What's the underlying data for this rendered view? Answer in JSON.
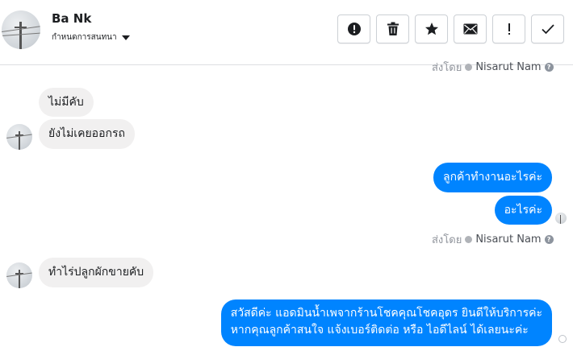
{
  "header": {
    "contact_name": "Ba Nk",
    "conversation_settings": "กำหนดการสนทนา",
    "toolbar": [
      {
        "name": "spam-button",
        "icon": "alert-circle-icon"
      },
      {
        "name": "delete-button",
        "icon": "trash-icon"
      },
      {
        "name": "star-button",
        "icon": "star-icon"
      },
      {
        "name": "mark-unread-button",
        "icon": "envelope-icon"
      },
      {
        "name": "follow-up-button",
        "icon": "exclamation-icon"
      },
      {
        "name": "mark-done-button",
        "icon": "checkmark-icon"
      }
    ]
  },
  "sent_by_label": "ส่งโดย",
  "agent_name": "Nisarut Nam",
  "messages": [
    {
      "direction": "in",
      "text": "ไม่มีคับ"
    },
    {
      "direction": "in",
      "text": "ยังไม่เคยออกรถ"
    },
    {
      "direction": "out",
      "text": "ลูกค้าทำงานอะไรค่ะ"
    },
    {
      "direction": "out",
      "text": "อะไรค่ะ"
    },
    {
      "direction": "in",
      "text": "ทำไร่ปลูกผักขายคับ"
    },
    {
      "direction": "out",
      "text_lines": [
        "สวัสดีค่ะ แอดมินน้ำเพจากร้านโชคคุณโชคอุดร ยินดีให้บริการค่ะ",
        "หากคุณลูกค้าสนใจ แจ้งเบอร์ติดต่อ หรือ ไอดีไลน์ ได้เลยนะค่ะ"
      ]
    }
  ],
  "colors": {
    "outgoing_bubble": "#0084ff",
    "incoming_bubble": "#f1f0f0"
  }
}
